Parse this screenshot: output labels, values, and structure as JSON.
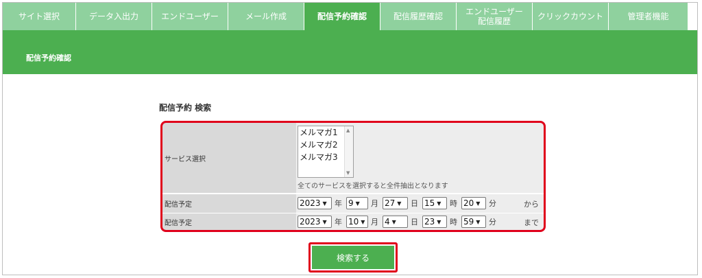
{
  "tabs": [
    {
      "label": "サイト選択",
      "width": 107
    },
    {
      "label": "データ入出力",
      "width": 111
    },
    {
      "label": "エンドユーザー",
      "width": 111
    },
    {
      "label": "メール作成",
      "width": 111
    },
    {
      "label": "配信予約確認",
      "width": 111,
      "active": true
    },
    {
      "label": "配信履歴確認",
      "width": 111
    },
    {
      "label": "エンドユーザー\n配信履歴",
      "width": 111
    },
    {
      "label": "クリックカウント",
      "width": 111
    },
    {
      "label": "管理者機能",
      "width": 111
    }
  ],
  "banner": {
    "title": "配信予約確認"
  },
  "search": {
    "title": "配信予約 検索",
    "service_label": "サービス選択",
    "services": [
      "メルマガ1",
      "メルマガ2",
      "メルマガ3"
    ],
    "service_note": "全てのサービスを選択すると全件抽出となります",
    "from": {
      "label": "配信予定",
      "year": "2023",
      "month": "9",
      "day": "27",
      "hour": "15",
      "minute": "20",
      "suffix": "から"
    },
    "to": {
      "label": "配信予定",
      "year": "2023",
      "month": "10",
      "day": "4",
      "hour": "23",
      "minute": "59",
      "suffix": "まで"
    },
    "units": {
      "year": "年",
      "month": "月",
      "day": "日",
      "hour": "時",
      "minute": "分"
    },
    "submit_label": "検索する"
  },
  "colors": {
    "accent": "#4caf50",
    "tab_inactive": "#8fd19e",
    "highlight": "#e0001b"
  }
}
